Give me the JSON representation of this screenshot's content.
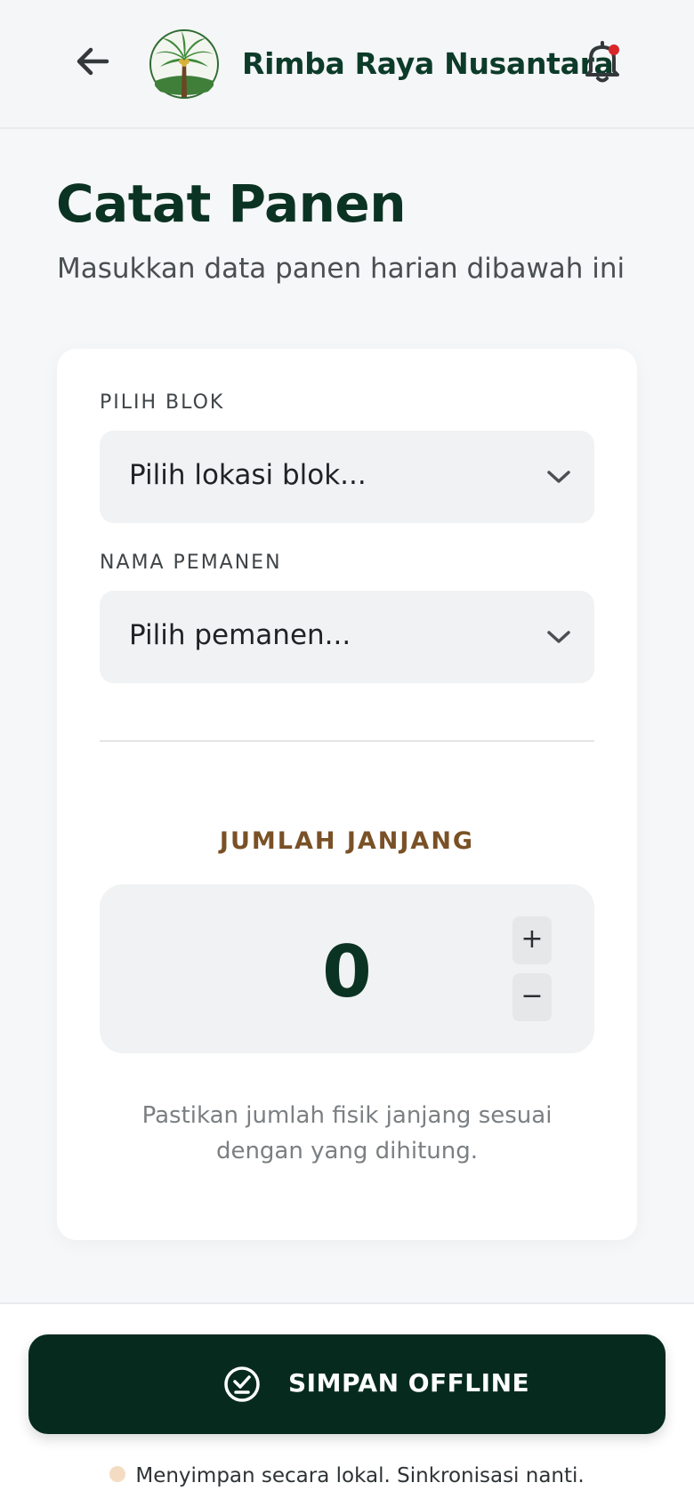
{
  "header": {
    "brand": "Rimba Raya Nusantara",
    "back_icon": "arrow-left-icon",
    "bell_icon": "bell-icon",
    "notification_dot_color": "#d9262b"
  },
  "page": {
    "title": "Catat Panen",
    "subtitle": "Masukkan data panen harian dibawah ini"
  },
  "form": {
    "block_label": "PILIH BLOK",
    "block_placeholder": "Pilih lokasi blok...",
    "harvester_label": "NAMA PEMANEN",
    "harvester_placeholder": "Pilih pemanen...",
    "counter_label": "JUMLAH JANJANG",
    "counter_value": "0",
    "plus": "+",
    "minus": "−",
    "note": "Pastikan jumlah fisik janjang sesuai dengan yang dihitung."
  },
  "footer": {
    "save_label": "SIMPAN OFFLINE",
    "save_icon": "check-circle-icon",
    "status_text": "Menyimpan secara lokal. Sinkronisasi nanti.",
    "status_dot_color": "#f4dcc3"
  },
  "colors": {
    "primary": "#062b1e",
    "accent_brown": "#7a5126",
    "background": "#f6f7f8"
  }
}
